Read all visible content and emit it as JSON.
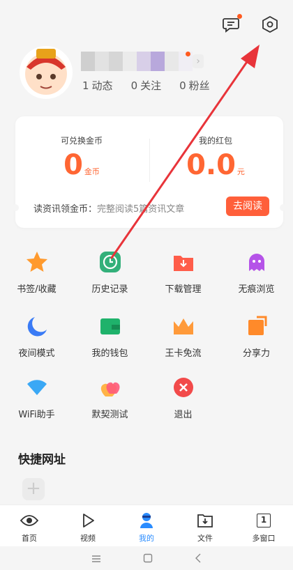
{
  "header": {
    "icons": [
      "message-icon",
      "settings-hexagon-icon"
    ]
  },
  "profile": {
    "stats": [
      {
        "num": "1",
        "label": "动态"
      },
      {
        "num": "0",
        "label": "关注"
      },
      {
        "num": "0",
        "label": "粉丝"
      }
    ]
  },
  "card": {
    "coins_label": "可兑换金币",
    "coins_value": "0",
    "coins_unit": "金币",
    "redpacket_label": "我的红包",
    "redpacket_value": "0.0",
    "redpacket_unit": "元",
    "cta_title": "读资讯领金币：",
    "cta_sub": "完整阅读5篇资讯文章",
    "cta_button": "去阅读"
  },
  "grid": [
    {
      "label": "书签/收藏",
      "icon": "star-icon"
    },
    {
      "label": "历史记录",
      "icon": "clock-icon"
    },
    {
      "label": "下载管理",
      "icon": "download-folder-icon"
    },
    {
      "label": "无痕浏览",
      "icon": "ghost-icon"
    },
    {
      "label": "夜间模式",
      "icon": "moon-icon"
    },
    {
      "label": "我的钱包",
      "icon": "wallet-icon"
    },
    {
      "label": "王卡免流",
      "icon": "crown-icon"
    },
    {
      "label": "分享力",
      "icon": "share-icon"
    },
    {
      "label": "WiFi助手",
      "icon": "wifi-icon"
    },
    {
      "label": "默契测试",
      "icon": "hearts-icon"
    },
    {
      "label": "退出",
      "icon": "exit-icon"
    }
  ],
  "shortcuts": {
    "title": "快捷网址",
    "add": "+"
  },
  "nav": [
    {
      "label": "首页",
      "icon": "eye-icon",
      "active": false
    },
    {
      "label": "视频",
      "icon": "play-icon",
      "active": false
    },
    {
      "label": "我的",
      "icon": "user-icon",
      "active": true
    },
    {
      "label": "文件",
      "icon": "folder-download-icon",
      "active": false
    },
    {
      "label": "多窗口",
      "icon": "window-count-icon",
      "active": false
    }
  ],
  "nav_window_count": "1",
  "colors": {
    "accent": "#ff6633",
    "active_blue": "#2a8cff",
    "annotation_arrow": "#e8343a"
  }
}
